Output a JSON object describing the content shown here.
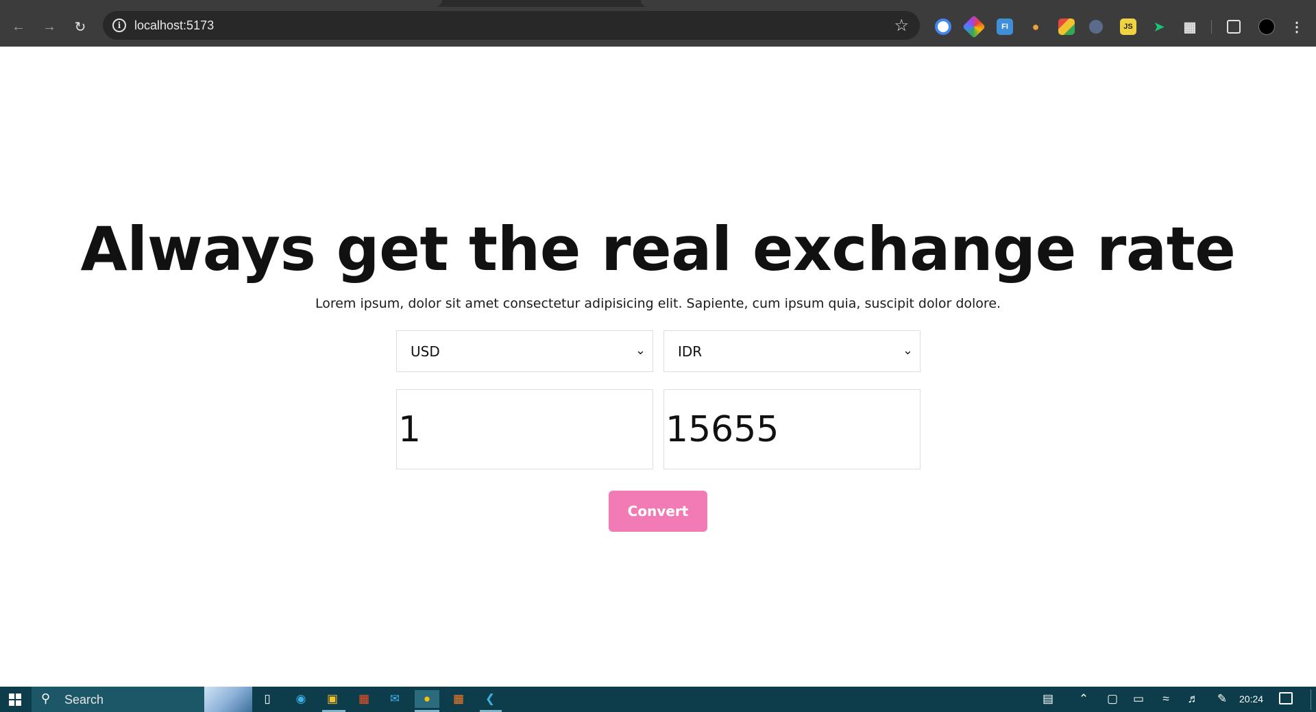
{
  "browser": {
    "url": "localhost:5173",
    "nav": {
      "back_icon": "arrow-left-icon",
      "forward_icon": "arrow-right-icon",
      "reload_icon": "reload-icon"
    },
    "extensions": [
      {
        "name": "ring-extension-icon",
        "color": "#4285f4"
      },
      {
        "name": "color-picker-extension-icon",
        "color": "#ea4335"
      },
      {
        "name": "fi-extension-icon",
        "color": "#3f8fd8",
        "label": "FI"
      },
      {
        "name": "cookie-extension-icon",
        "color": "#e8a33c"
      },
      {
        "name": "grid-extension-icon",
        "color": "#e84b3c"
      },
      {
        "name": "cursor-extension-icon",
        "color": "#5a6b8c"
      },
      {
        "name": "js-extension-icon",
        "color": "#f0d340",
        "label": "JS"
      },
      {
        "name": "bird-extension-icon",
        "color": "#1bc47d"
      }
    ]
  },
  "page": {
    "title": "Always get the real exchange rate",
    "subtitle": "Lorem ipsum, dolor sit amet consectetur adipisicing elit. Sapiente, cum ipsum quia, suscipit dolor dolore.",
    "from_currency": "USD",
    "to_currency": "IDR",
    "from_amount": "1",
    "to_amount": "15655",
    "convert_label": "Convert"
  },
  "taskbar": {
    "search_label": "Search",
    "time": "20:24"
  },
  "colors": {
    "accent": "#f37bb5",
    "chrome_bg": "#3c3c3c",
    "taskbar_bg": "#0d3d4a"
  }
}
